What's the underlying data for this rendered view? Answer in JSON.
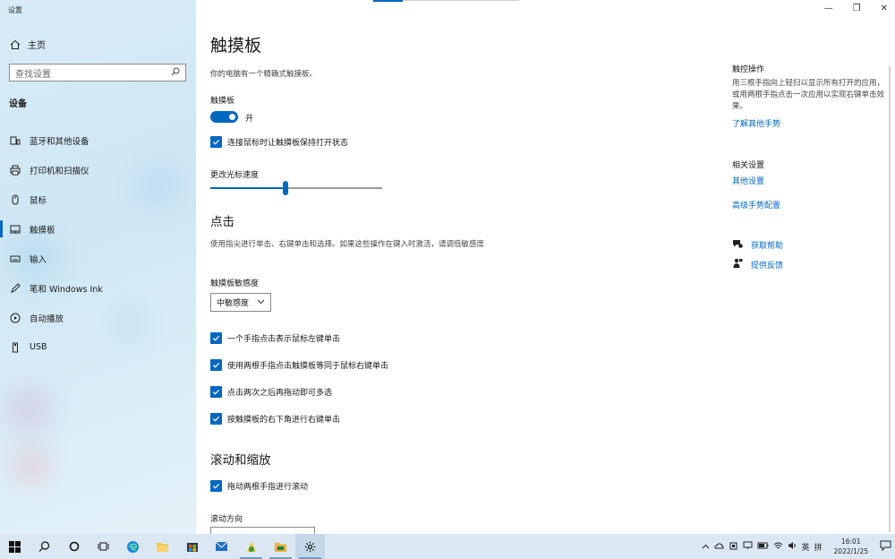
{
  "window": {
    "title": "设置",
    "controls": [
      "—",
      "❐",
      "✕"
    ]
  },
  "sidebar": {
    "home": "主页",
    "search_placeholder": "查找设置",
    "section": "设备",
    "items": [
      {
        "label": "蓝牙和其他设备",
        "icon": "bluetooth-devices-icon"
      },
      {
        "label": "打印机和扫描仪",
        "icon": "printer-icon"
      },
      {
        "label": "鼠标",
        "icon": "mouse-icon"
      },
      {
        "label": "触摸板",
        "icon": "touchpad-icon",
        "active": true
      },
      {
        "label": "输入",
        "icon": "keyboard-icon"
      },
      {
        "label": "笔和 Windows Ink",
        "icon": "pen-icon"
      },
      {
        "label": "自动播放",
        "icon": "autoplay-icon"
      },
      {
        "label": "USB",
        "icon": "usb-icon"
      }
    ]
  },
  "main": {
    "title": "触摸板",
    "description": "你的电脑有一个精确式触摸板。",
    "touchpad_label": "触摸板",
    "toggle_state": "开",
    "keep_on_with_mouse": "连接鼠标时让触摸板保持打开状态",
    "cursor_speed_label": "更改光标速度",
    "cursor_speed_fraction": 0.44,
    "taps_heading": "点击",
    "taps_desc": "使用指尖进行单击、右键单击和选择。如果这些操作在键入时激活，请调低敏感度",
    "sensitivity_label": "触摸板敏感度",
    "sensitivity_value": "中敏感度",
    "tap_options": [
      "一个手指点击表示鼠标左键单击",
      "使用两根手指点击触摸板等同于鼠标右键单击",
      "点击两次之后再拖动即可多选",
      "按触摸板的右下角进行右键单击"
    ],
    "scroll_heading": "滚动和缩放",
    "scroll_option": "拖动两根手指进行滚动",
    "scroll_direction_label": "滚动方向"
  },
  "right": {
    "gestures_title": "触控操作",
    "gestures_text": "用三根手指向上轻扫以显示所有打开的应用，或用两根手指点击一次应用以实现右键单击效果。",
    "learn_more": "了解其他手势",
    "related_title": "相关设置",
    "other_settings": "其他设置",
    "advanced_gestures": "高级手势配置",
    "get_help": "获取帮助",
    "feedback": "提供反馈"
  },
  "taskbar": {
    "time": "16:01",
    "date": "2022/1/25",
    "ime_lang": "英",
    "ime_mode": "拼"
  },
  "colors": {
    "accent": "#0067c0",
    "sidebar_bg": "#d6eaf6",
    "taskbar_bg": "#dbe8f3"
  }
}
